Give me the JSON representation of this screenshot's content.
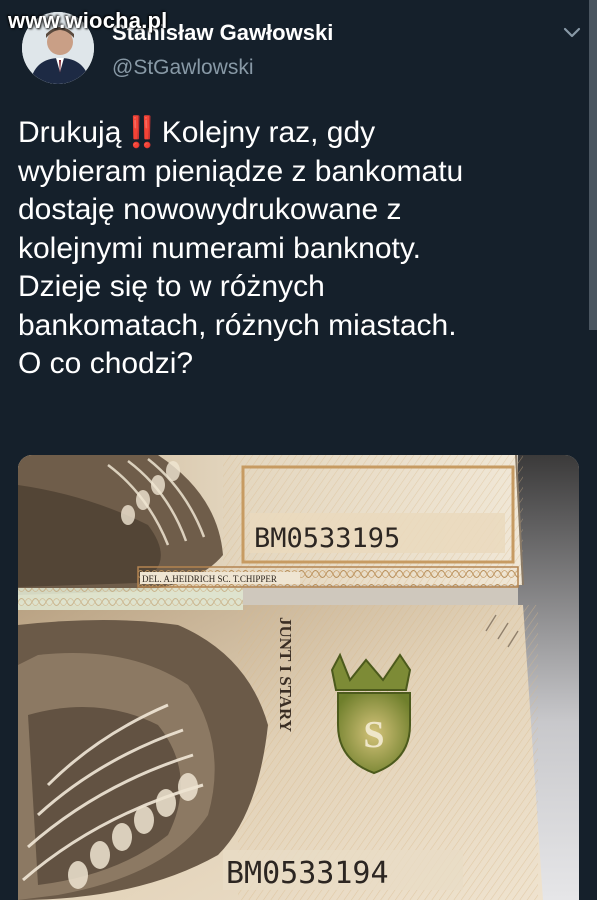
{
  "watermark": "www.wiocha.pl",
  "header": {
    "display_name": "Stanisław Gawłowski",
    "handle": "@StGawlowski",
    "menu_icon": "chevron-down-icon"
  },
  "tweet": {
    "lines": [
      "Drukują",
      "Kolejny raz, gdy",
      "wybieram pieniądze z bankomatu",
      "dostaję nowowydrukowane z",
      "kolejnymi numerami banknoty.",
      "Dzieje się to w różnych",
      "bankomatach, różnych miastach.",
      "O co chodzi?"
    ],
    "emoji": "‼️"
  },
  "media": {
    "serial_top": "BM0533195",
    "serial_bottom": "BM0533194",
    "engraver_text": "DEL. A.HEIDRICH SC. T.CHIPPER",
    "vertical_text": "JUNT I STARY",
    "colors": {
      "note_base": "#d9cbb2",
      "note_tan": "#c8a778",
      "note_green": "#7f8f3e",
      "note_dark": "#4a3a2c"
    }
  }
}
